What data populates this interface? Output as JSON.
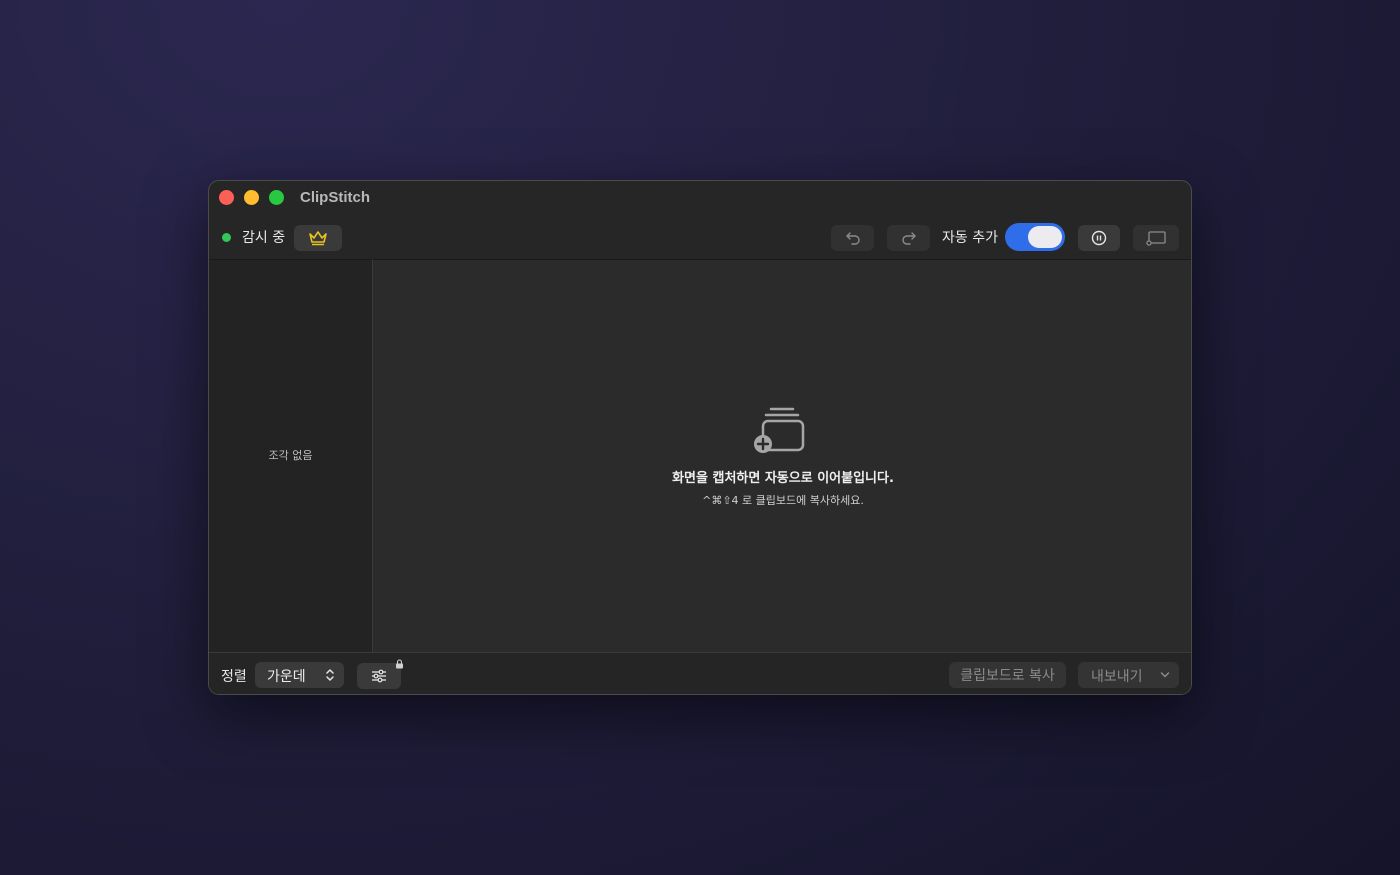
{
  "window": {
    "title": "ClipStitch"
  },
  "toolbar": {
    "status_label": "감시 중",
    "status_color": "#33c759",
    "crown_icon": "crown-icon",
    "undo_icon": "undo-arrow-icon",
    "redo_icon": "redo-arrow-icon",
    "auto_add_label": "자동 추가",
    "auto_add_enabled": true,
    "pause_icon": "pause-circle-icon",
    "cast_icon": "screen-cast-icon"
  },
  "sidebar": {
    "empty_text": "조각 없음"
  },
  "canvas": {
    "empty_icon": "stack-add-icon",
    "empty_title": "화면을 캡처하면 자동으로 이어붙입니다.",
    "empty_subtitle": "^⌘⇧4 로 클립보드에 복사하세요."
  },
  "footer": {
    "align_label": "정렬",
    "align_value": "가운데",
    "settings_icon": "sliders-icon",
    "lock_icon": "lock-icon",
    "copy_label": "클립보드로 복사",
    "export_label": "내보내기"
  },
  "colors": {
    "accent": "#2f6ee8",
    "crown": "#e8c21e",
    "close": "#fe5f57",
    "minimize": "#febc2e",
    "maximize": "#28c840"
  }
}
